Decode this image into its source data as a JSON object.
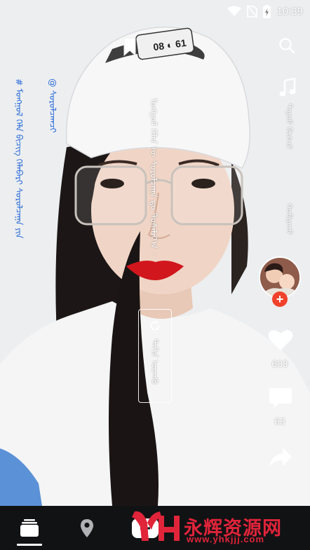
{
  "status_bar": {
    "time": "10:39",
    "icons": [
      "wifi-icon",
      "no-sim-icon",
      "battery-charging-icon"
    ]
  },
  "video": {
    "hashtags": "# ᠮᠣᠩᠭᠣᠯ ᠬᠡᠯᠡ ᠪᠢᠴᠢᠭ ᠬᠡᠯᠡᠪᠡᠷᠢ ᠰᠤᠷᠤᠯᠴᠠᠭᠠ ᠶᠢᠨ",
    "author": "@ ᠰᠤᠷᠤᠯᠴᠠᠭᠴᠢ",
    "caption": "ᠮᠣᠩᠭᠣᠯ ᠬᠡᠯᠡᠨ ᠦ ᠰᠤᠷᠤᠯᠴᠠᠭᠠ ᠳᠤ ᠲᠤᠰᠠᠯᠠᠶ᠎ᠠ ᠂",
    "replay_label": "ᠳᠠᠬᠢᠨ ᠦᠵᠡᠬᠦ"
  },
  "actions": {
    "music_text": "ᠳᠠᠭᠤᠤ ᠬᠦᠭᠵᠢᠮ",
    "share_text": "ᠬᠤᠪᠢᠶᠠᠬᠤ",
    "like_count": "603",
    "comment_count": "63"
  },
  "watermark": {
    "cn": "永辉资源网",
    "url": "www.yhkjjj.com"
  },
  "colors": {
    "accent_blue": "#2a6bd8",
    "follow_red": "#f0422b",
    "nav_bg": "#111214",
    "watermark_red": "#e0243a"
  }
}
